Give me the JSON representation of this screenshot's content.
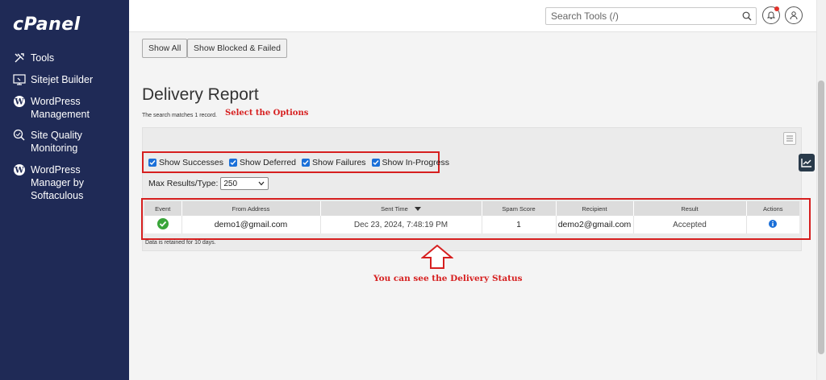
{
  "sidebar": {
    "logo": "cPanel",
    "items": [
      {
        "label": "Tools",
        "icon": "tools-icon"
      },
      {
        "label": "Sitejet Builder",
        "icon": "sitejet-icon"
      },
      {
        "label": "WordPress\nManagement",
        "icon": "wordpress-icon"
      },
      {
        "label": "Site Quality\nMonitoring",
        "icon": "site-quality-icon"
      },
      {
        "label": "WordPress\nManager by\nSoftaculous",
        "icon": "wordpress-icon"
      }
    ]
  },
  "topbar": {
    "search_placeholder": "Search Tools (/)",
    "icons": [
      "search-icon",
      "notification-bell-icon",
      "user-icon"
    ],
    "notification_dot_color": "#e0322b"
  },
  "toolbar": {
    "show_all": "Show All",
    "show_blocked_failed": "Show Blocked & Failed"
  },
  "page": {
    "title": "Delivery Report",
    "match_text": "The search matches 1 record.",
    "retained_note": "Data is retained for 10 days."
  },
  "annotations": {
    "select_options": "Select the Options",
    "delivery_status": "You can see the Delivery Status",
    "color": "#d61f1f"
  },
  "filters": {
    "options": [
      {
        "label": "Show Successes",
        "checked": true
      },
      {
        "label": "Show Deferred",
        "checked": true
      },
      {
        "label": "Show Failures",
        "checked": true
      },
      {
        "label": "Show In-Progress",
        "checked": true
      }
    ],
    "max_results_label": "Max Results/Type:",
    "max_results_value": "250"
  },
  "table": {
    "headers": [
      "Event",
      "From Address",
      "Sent Time",
      "Spam Score",
      "Recipient",
      "Result",
      "Actions"
    ],
    "rows": [
      {
        "event_icon": "check-circle-icon",
        "from": "demo1@gmail.com",
        "sent_time": "Dec 23, 2024, 7:48:19 PM",
        "spam_score": "1",
        "recipient": "demo2@gmail.com",
        "result": "Accepted",
        "action_icon": "info-icon"
      }
    ]
  },
  "colors": {
    "sidebar_bg": "#1f2a56",
    "checkbox": "#1a6fd8",
    "success": "#3aa53a",
    "info": "#1a6fd8"
  }
}
